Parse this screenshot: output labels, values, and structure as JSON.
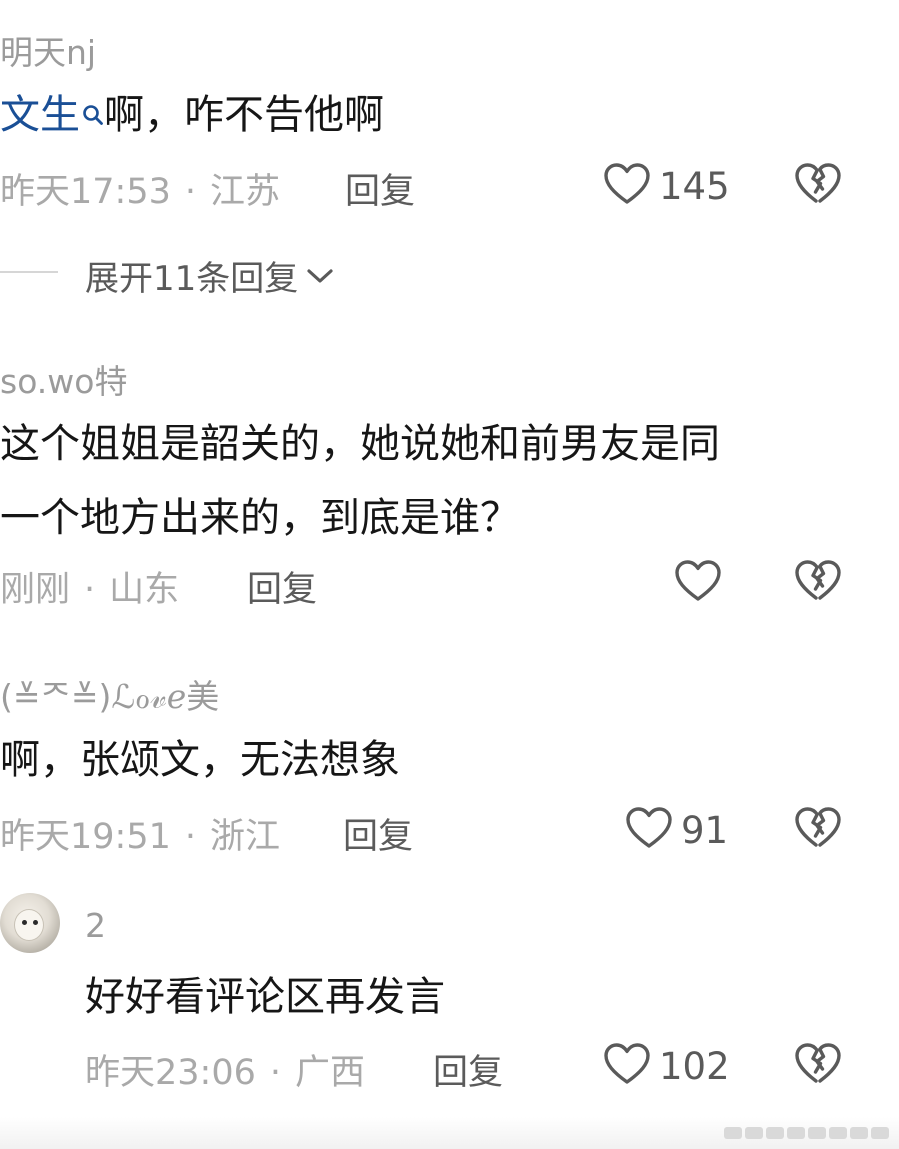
{
  "comments": [
    {
      "username": "明天nj",
      "link_text": "文生",
      "content": "啊，咋不告他啊",
      "time": "昨天17:53",
      "location": "江苏",
      "reply_label": "回复",
      "likes": "145"
    },
    {
      "username": "so.wo特",
      "content_line1": "这个姐姐是韶关的，她说她和前男友是同",
      "content_line2": "一个地方出来的，到底是谁？",
      "time": "刚刚",
      "location": "山东",
      "reply_label": "回复",
      "likes": ""
    },
    {
      "username": "(≚ᄌ≚)ℒℴ𝓋ℯ美",
      "content": "啊，张颂文，无法想象",
      "time": "昨天19:51",
      "location": "浙江",
      "reply_label": "回复",
      "likes": "91"
    },
    {
      "username": "2",
      "content": "好好看评论区再发言",
      "time": "昨天23:06",
      "location": "广西",
      "reply_label": "回复",
      "likes": "102"
    }
  ],
  "expand_replies": "展开11条回复",
  "meta_separator": "·",
  "colors": {
    "link": "#1a4f96",
    "meta": "#a9a9a9",
    "text": "#161616"
  },
  "icons": [
    "search-icon",
    "heart-icon",
    "broken-heart-icon",
    "chevron-down-icon"
  ]
}
